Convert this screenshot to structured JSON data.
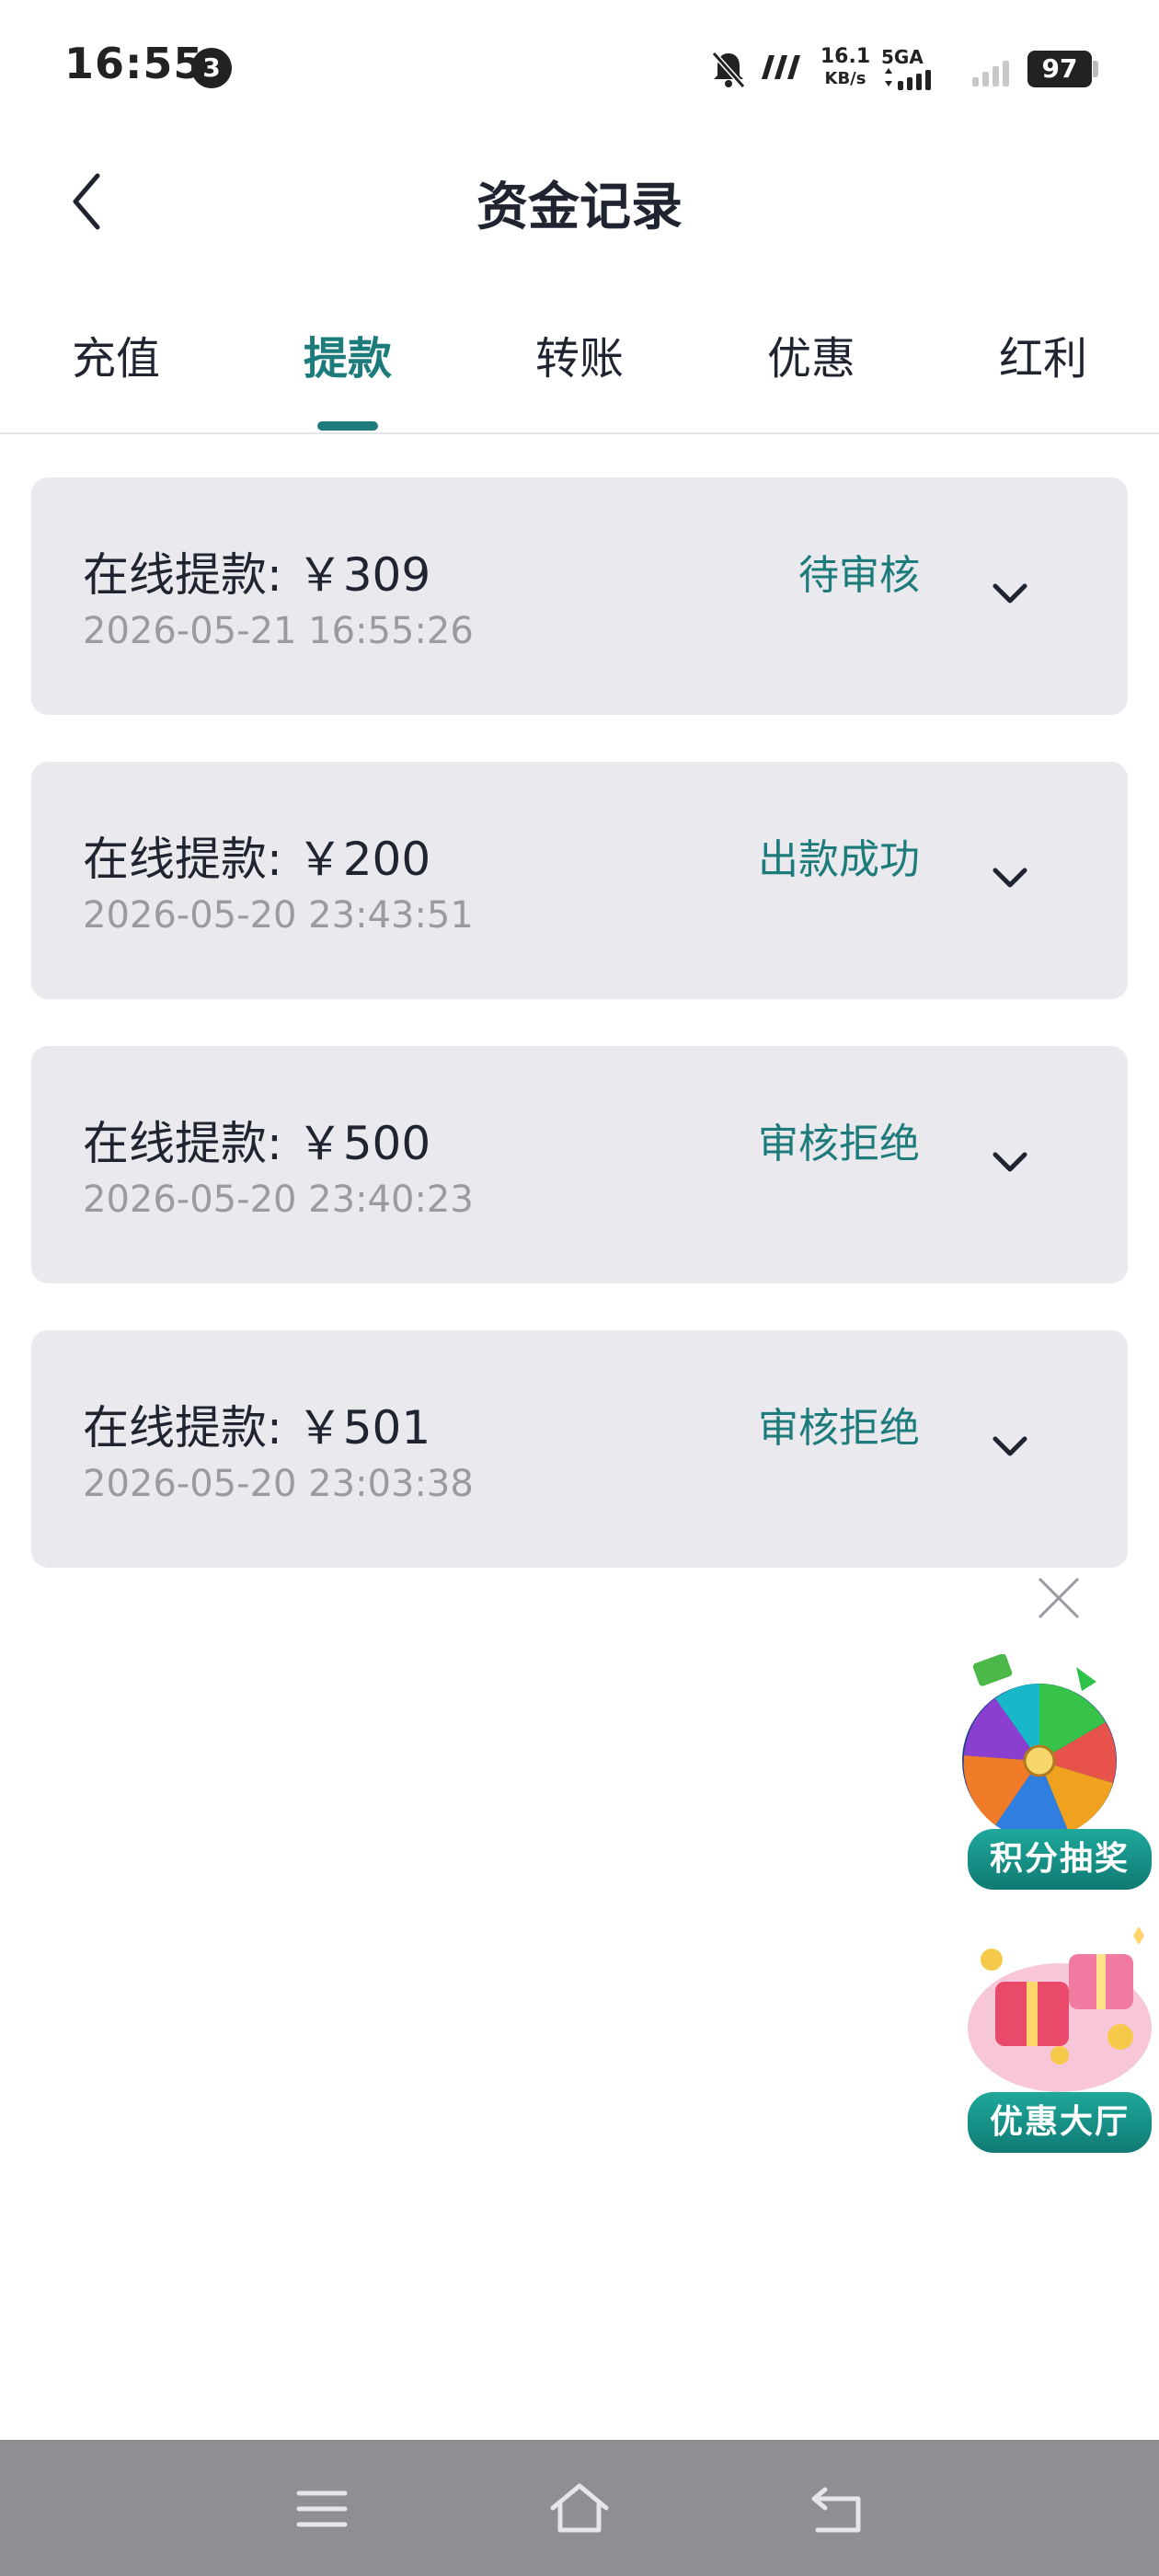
{
  "status_bar": {
    "time": "16:55",
    "notification_count": "3",
    "net_speed_value": "16.1",
    "net_speed_unit": "KB/s",
    "network_type": "5GA",
    "battery": "97"
  },
  "header": {
    "title": "资金记录"
  },
  "tabs": [
    {
      "label": "充值"
    },
    {
      "label": "提款"
    },
    {
      "label": "转账"
    },
    {
      "label": "优惠"
    },
    {
      "label": "红利"
    }
  ],
  "active_tab": "提款",
  "records": [
    {
      "title": "在线提款: ￥309",
      "time": "2026-05-21 16:55:26",
      "status": "待审核"
    },
    {
      "title": "在线提款: ￥200",
      "time": "2026-05-20 23:43:51",
      "status": "出款成功"
    },
    {
      "title": "在线提款: ￥500",
      "time": "2026-05-20 23:40:23",
      "status": "审核拒绝"
    },
    {
      "title": "在线提款: ￥501",
      "time": "2026-05-20 23:03:38",
      "status": "审核拒绝"
    }
  ],
  "floating": {
    "lottery_label": "积分抽奖",
    "promo_label": "优惠大厅"
  },
  "colors": {
    "accent": "#1d7b7b",
    "card_bg": "#e9e9ee",
    "nav_bar": "#8e8e93"
  },
  "icons": {
    "back": "chevron-left-icon",
    "expand": "chevron-down-icon",
    "close": "close-icon",
    "menu": "menu-icon",
    "home": "home-icon",
    "return": "back-icon"
  }
}
